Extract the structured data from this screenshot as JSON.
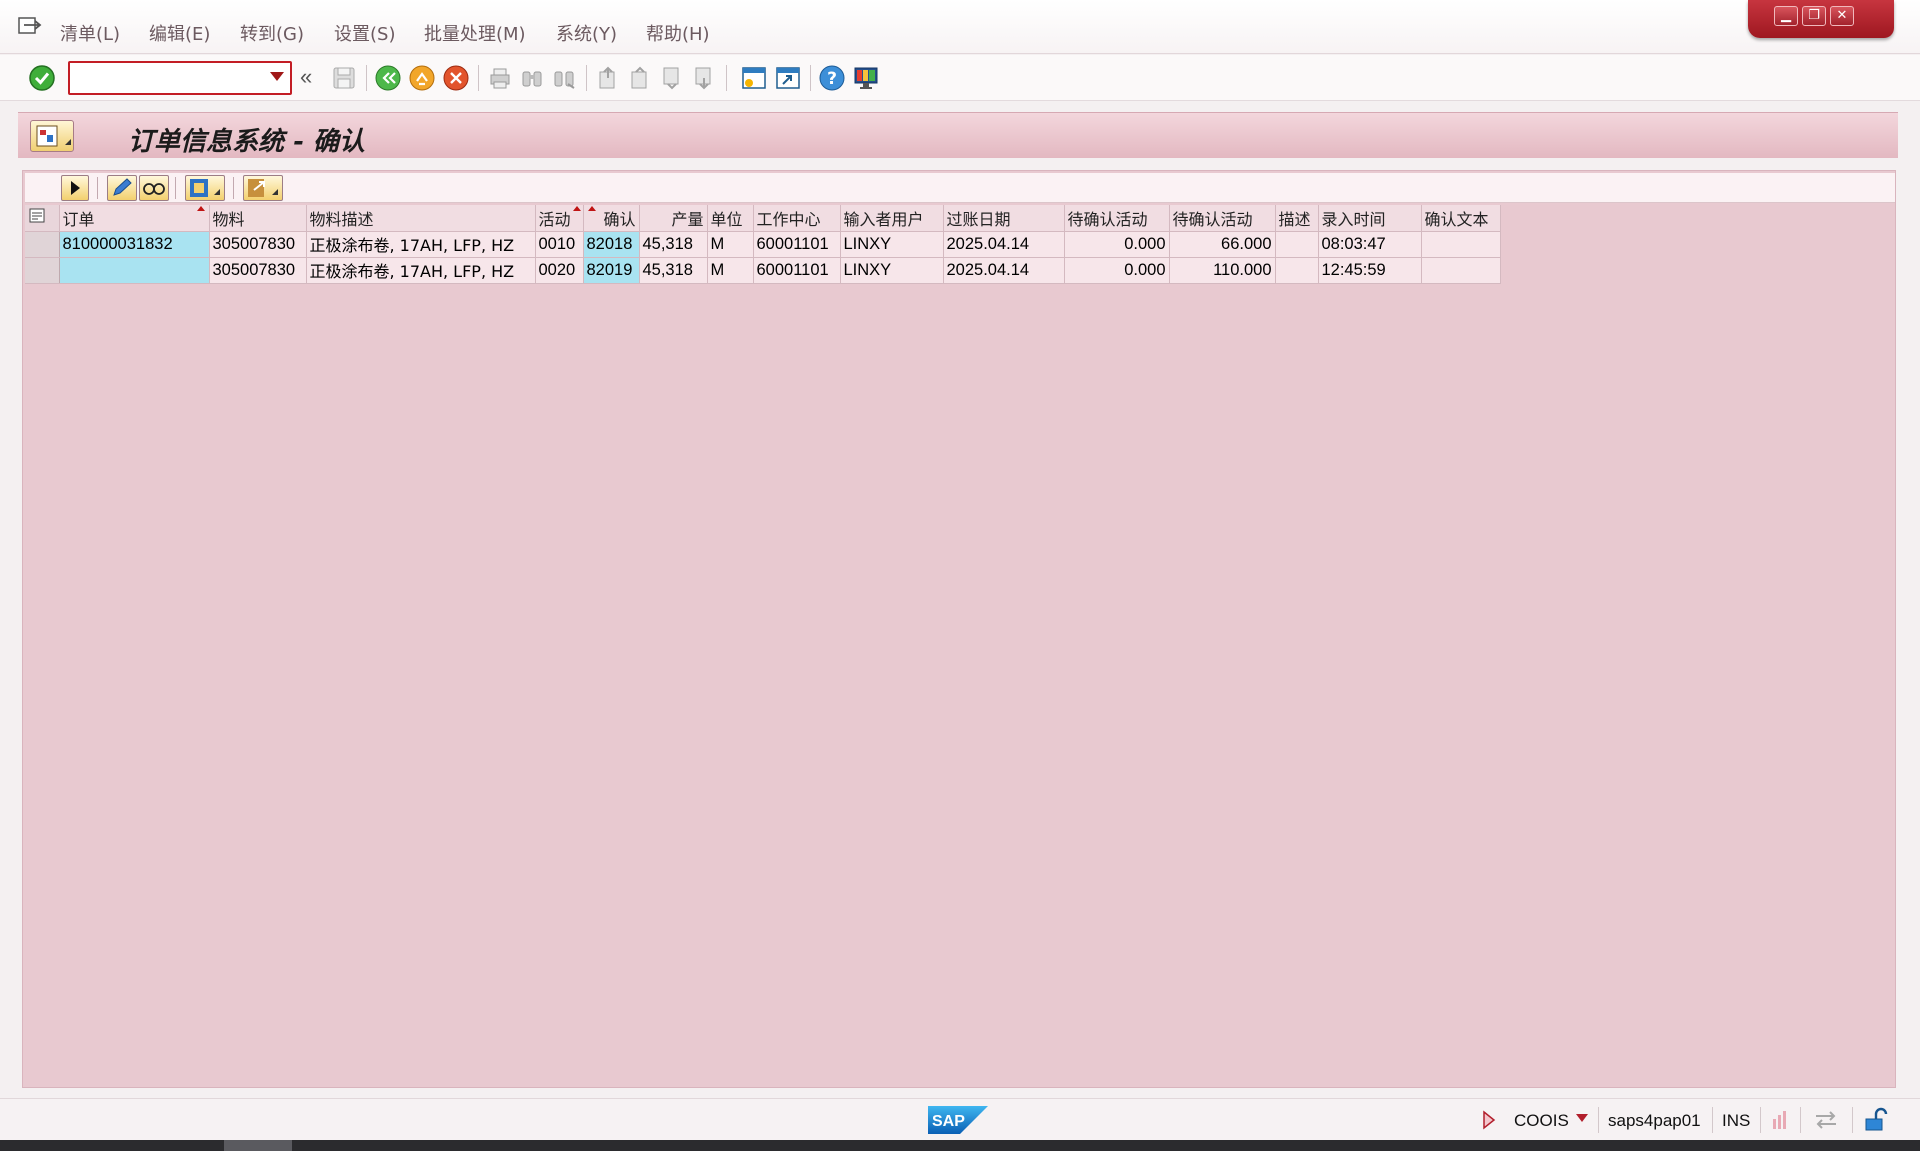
{
  "menu": {
    "items": [
      "清单(L)",
      "编辑(E)",
      "转到(G)",
      "设置(S)",
      "批量处理(M)",
      "系统(Y)",
      "帮助(H)"
    ]
  },
  "window_controls": {
    "minimize": "▁",
    "restore": "❐",
    "close": "✕"
  },
  "toolbar": {
    "command_field_value": "",
    "collapse_glyph": "«"
  },
  "title": "订单信息系统 - 确认",
  "grid": {
    "columns": [
      "订单",
      "物料",
      "物料描述",
      "活动",
      "确认",
      "产量",
      "单位",
      "工作中心",
      "输入者用户",
      "过账日期",
      "待确认活动",
      "待确认活动",
      "描述",
      "录入时间",
      "确认文本"
    ],
    "rows": [
      [
        "810000031832",
        "305007830",
        "正极涂布卷, 17AH,  LFP, HZ",
        "0010",
        "82018",
        "45,318",
        "M",
        "60001101",
        "LINXY",
        "2025.04.14",
        "0.000",
        "66.000",
        "",
        "08:03:47",
        ""
      ],
      [
        "",
        "305007830",
        "正极涂布卷, 17AH,  LFP, HZ",
        "0020",
        "82019",
        "45,318",
        "M",
        "60001101",
        "LINXY",
        "2025.04.14",
        "0.000",
        "110.000",
        "",
        "12:45:59",
        ""
      ]
    ]
  },
  "status": {
    "logo": "SAP",
    "transaction": "COOIS",
    "server": "saps4pap01",
    "mode": "INS"
  },
  "colors": {
    "accent": "#c31d25",
    "title_band": "#e3b8c1",
    "content_bg": "#e8c9d0",
    "key_cell": "#a9e3f1"
  }
}
